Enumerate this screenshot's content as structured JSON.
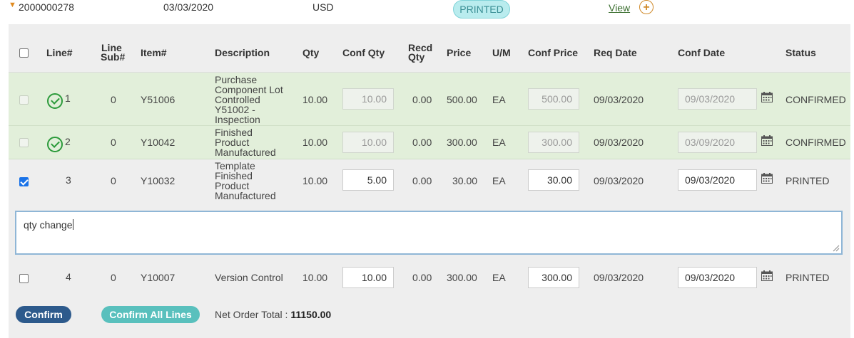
{
  "order": {
    "number": "2000000278",
    "date": "03/03/2020",
    "currency": "USD",
    "status": "PRINTED",
    "view_label": "View",
    "add_label": "+"
  },
  "columns": {
    "line": "Line#",
    "line_sub_1": "Line",
    "line_sub_2": "Sub#",
    "item": "Item#",
    "description": "Description",
    "qty": "Qty",
    "conf_qty": "Conf Qty",
    "recd_1": "Recd",
    "recd_2": "Qty",
    "price": "Price",
    "um": "U/M",
    "conf_price": "Conf Price",
    "req_date": "Req Date",
    "conf_date": "Conf Date",
    "status": "Status"
  },
  "rows": [
    {
      "line": "1",
      "sub": "0",
      "item": "Y51006",
      "desc": [
        "Purchase",
        "Component Lot",
        "Controlled",
        "Y51002 -",
        "Inspection"
      ],
      "qty": "10.00",
      "conf_qty": "10.00",
      "recd": "0.00",
      "price": "500.00",
      "um": "EA",
      "conf_price": "500.00",
      "req_date": "09/03/2020",
      "conf_date": "09/03/2020",
      "status": "CONFIRMED"
    },
    {
      "line": "2",
      "sub": "0",
      "item": "Y10042",
      "desc": [
        "Finished",
        "Product",
        "Manufactured"
      ],
      "qty": "10.00",
      "conf_qty": "10.00",
      "recd": "0.00",
      "price": "300.00",
      "um": "EA",
      "conf_price": "300.00",
      "req_date": "09/03/2020",
      "conf_date": "03/09/2020",
      "status": "CONFIRMED"
    },
    {
      "line": "3",
      "sub": "0",
      "item": "Y10032",
      "desc": [
        "Template",
        "Finished",
        "Product",
        "Manufactured"
      ],
      "qty": "10.00",
      "conf_qty": "5.00",
      "recd": "0.00",
      "price": "30.00",
      "um": "EA",
      "conf_price": "30.00",
      "req_date": "09/03/2020",
      "conf_date": "09/03/2020",
      "status": "PRINTED"
    },
    {
      "line": "4",
      "sub": "0",
      "item": "Y10007",
      "desc": [
        "Version Control"
      ],
      "qty": "10.00",
      "conf_qty": "10.00",
      "recd": "0.00",
      "price": "300.00",
      "um": "EA",
      "conf_price": "300.00",
      "req_date": "09/03/2020",
      "conf_date": "09/03/2020",
      "status": "PRINTED"
    }
  ],
  "comment": "qty change",
  "footer": {
    "confirm_label": "Confirm",
    "confirm_all_label": "Confirm All Lines",
    "total_label": "Net Order Total :",
    "total_value": "11150.00"
  },
  "colors": {
    "confirm": "#2d5a8c",
    "confirm_all": "#59c0bd",
    "confirmed_row": "#e2efda",
    "status_pill": "#b9ecee"
  }
}
